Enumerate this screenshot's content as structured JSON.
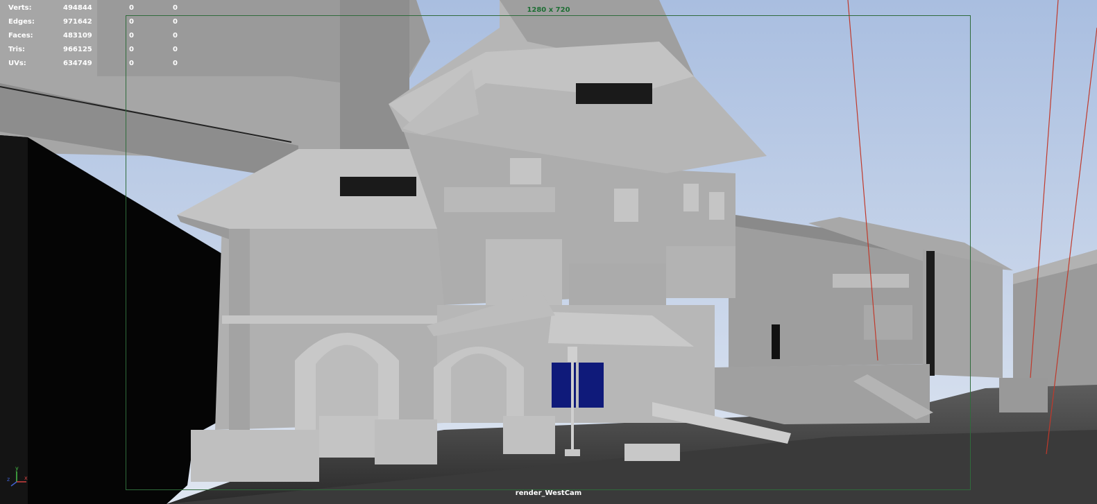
{
  "stats": [
    {
      "label": "Verts:",
      "value": "494844",
      "selected": "0",
      "triangles_selected": "0"
    },
    {
      "label": "Edges:",
      "value": "971642",
      "selected": "0",
      "triangles_selected": "0"
    },
    {
      "label": "Faces:",
      "value": "483109",
      "selected": "0",
      "triangles_selected": "0"
    },
    {
      "label": "Tris:",
      "value": "966125",
      "selected": "0",
      "triangles_selected": "0"
    },
    {
      "label": "UVs:",
      "value": "634749",
      "selected": "0",
      "triangles_selected": "0"
    }
  ],
  "resolution_gate_label": "1280 x 720",
  "camera_label": "render_WestCam",
  "axis": {
    "y": "y",
    "x": "x",
    "z": "z"
  },
  "colors": {
    "sky": "#c9d6ea",
    "gate_border": "#2f6b3b",
    "hud_text": "#ffffff",
    "resolution_text": "#1e6e34",
    "window_glass": "#0f1a7a",
    "red_lines": "#c0392b"
  }
}
